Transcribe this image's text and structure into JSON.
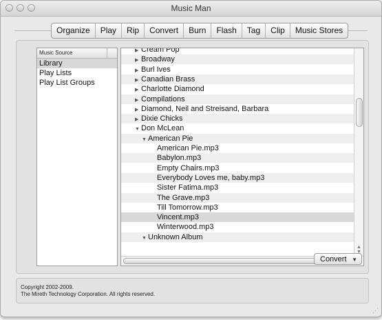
{
  "window": {
    "title": "Music Man"
  },
  "tabs": [
    "Organize",
    "Play",
    "Rip",
    "Convert",
    "Burn",
    "Flash",
    "Tag",
    "Clip",
    "Music Stores"
  ],
  "source": {
    "header": "Music Source",
    "items": [
      "Library",
      "Play Lists",
      "Play List Groups"
    ],
    "selected_index": 0
  },
  "tree": {
    "rows": [
      {
        "text": "Cream Pop",
        "level": 1,
        "expand": "collapsed",
        "partial": true
      },
      {
        "text": "Broadway",
        "level": 1,
        "expand": "collapsed"
      },
      {
        "text": "Burl Ives",
        "level": 1,
        "expand": "collapsed"
      },
      {
        "text": "Canadian Brass",
        "level": 1,
        "expand": "collapsed"
      },
      {
        "text": "Charlotte Diamond",
        "level": 1,
        "expand": "collapsed"
      },
      {
        "text": "Compilations",
        "level": 1,
        "expand": "collapsed"
      },
      {
        "text": "Diamond, Neil and Streisand, Barbara",
        "level": 1,
        "expand": "collapsed"
      },
      {
        "text": "Dixie Chicks",
        "level": 1,
        "expand": "collapsed"
      },
      {
        "text": "Don McLean",
        "level": 1,
        "expand": "expanded"
      },
      {
        "text": "American Pie",
        "level": 2,
        "expand": "expanded"
      },
      {
        "text": "American Pie.mp3",
        "level": 3,
        "expand": "none"
      },
      {
        "text": "Babylon.mp3",
        "level": 3,
        "expand": "none"
      },
      {
        "text": "Empty Chairs.mp3",
        "level": 3,
        "expand": "none"
      },
      {
        "text": "Everybody Loves me, baby.mp3",
        "level": 3,
        "expand": "none"
      },
      {
        "text": "Sister Fatima.mp3",
        "level": 3,
        "expand": "none"
      },
      {
        "text": "The Grave.mp3",
        "level": 3,
        "expand": "none"
      },
      {
        "text": "Till Tomorrow.mp3",
        "level": 3,
        "expand": "none"
      },
      {
        "text": "Vincent.mp3",
        "level": 3,
        "expand": "none",
        "selected": true
      },
      {
        "text": "Winterwood.mp3",
        "level": 3,
        "expand": "none"
      },
      {
        "text": "Unknown Album",
        "level": 2,
        "expand": "expanded",
        "partial": true
      }
    ]
  },
  "convert_button": {
    "label": "Convert"
  },
  "footer": {
    "line1": "Copyright 2002-2009.",
    "line2": "The Mireth Technology Corporation. All rights reserved."
  },
  "icons": {
    "collapsed": "▶",
    "expanded": "▼",
    "dropdown": "▼",
    "scroll_up": "▲",
    "scroll_down": "▼",
    "scroll_left": "◀",
    "scroll_right": "▶",
    "resize": "⋰"
  }
}
